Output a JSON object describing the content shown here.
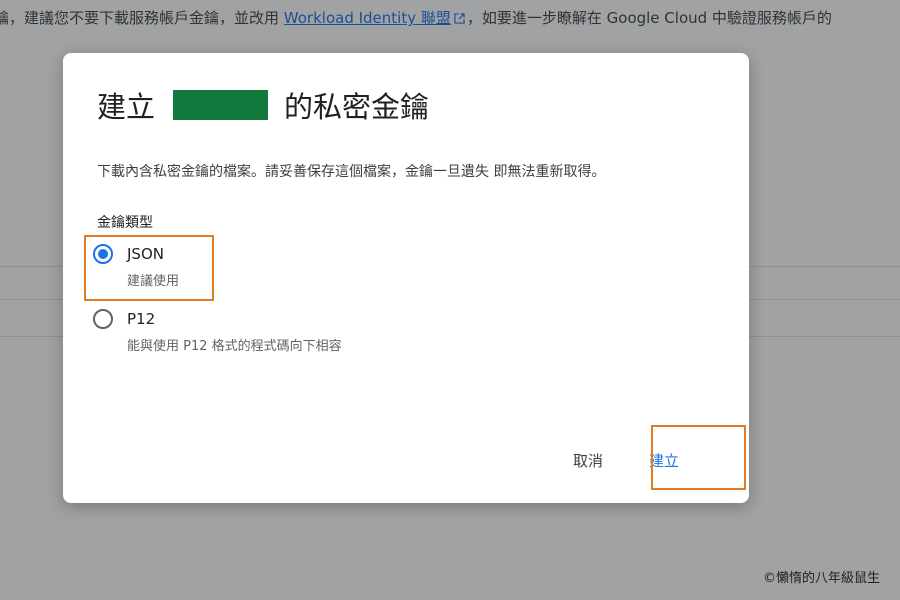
{
  "background": {
    "banner_lead": "鑰，建議您不要下載服務帳戶金鑰，並改用",
    "banner_link": "Workload Identity 聯盟",
    "banner_tail": "，如要進一步瞭解在 Google Cloud 中驗證服務帳戶的"
  },
  "dialog": {
    "title_prefix": "建立",
    "title_suffix": "的私密金鑰",
    "description": "下載內含私密金鑰的檔案。請妥善保存這個檔案，金鑰一旦遺失 即無法重新取得。",
    "key_type_label": "金鑰類型",
    "options": [
      {
        "label": "JSON",
        "hint": "建議使用",
        "selected": true
      },
      {
        "label": "P12",
        "hint": "能與使用 P12 格式的程式碼向下相容",
        "selected": false
      }
    ],
    "cancel_label": "取消",
    "create_label": "建立"
  },
  "watermark": "©懶惰的八年級鼠生",
  "colors": {
    "accent": "#1a73e8",
    "highlight": "#e07d1f",
    "redaction": "#127a3d"
  }
}
